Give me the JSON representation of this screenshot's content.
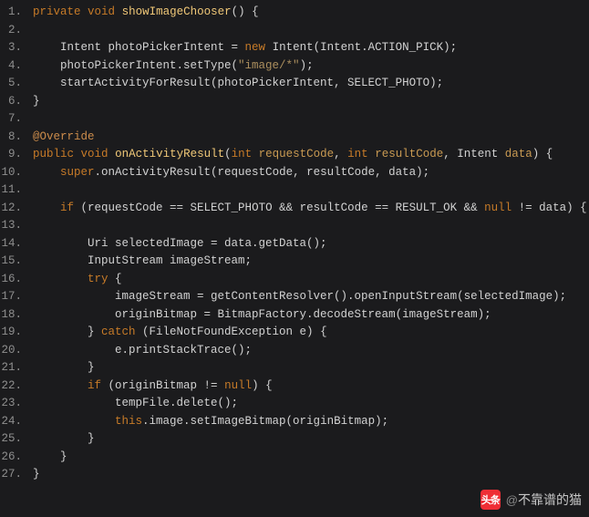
{
  "lines": [
    {
      "n": "1.",
      "segs": [
        {
          "c": "kw",
          "t": "private"
        },
        {
          "t": " "
        },
        {
          "c": "kw",
          "t": "void"
        },
        {
          "t": " "
        },
        {
          "c": "fn",
          "t": "showImageChooser"
        },
        {
          "t": "() {"
        }
      ]
    },
    {
      "n": "2.",
      "segs": []
    },
    {
      "n": "3.",
      "segs": [
        {
          "t": "    Intent photoPickerIntent = "
        },
        {
          "c": "kw",
          "t": "new"
        },
        {
          "t": " Intent(Intent.ACTION_PICK);"
        }
      ]
    },
    {
      "n": "4.",
      "segs": [
        {
          "t": "    photoPickerIntent.setType("
        },
        {
          "c": "str",
          "t": "\"image/*\""
        },
        {
          "t": ");"
        }
      ]
    },
    {
      "n": "5.",
      "segs": [
        {
          "t": "    startActivityForResult(photoPickerIntent, SELECT_PHOTO);"
        }
      ]
    },
    {
      "n": "6.",
      "segs": [
        {
          "t": "}"
        }
      ]
    },
    {
      "n": "7.",
      "segs": []
    },
    {
      "n": "8.",
      "segs": [
        {
          "c": "ann",
          "t": "@Override"
        }
      ]
    },
    {
      "n": "9.",
      "segs": [
        {
          "c": "kw",
          "t": "public"
        },
        {
          "t": " "
        },
        {
          "c": "kw",
          "t": "void"
        },
        {
          "t": " "
        },
        {
          "c": "fn",
          "t": "onActivityResult"
        },
        {
          "t": "("
        },
        {
          "c": "kw",
          "t": "int"
        },
        {
          "t": " "
        },
        {
          "c": "param",
          "t": "requestCode"
        },
        {
          "t": ", "
        },
        {
          "c": "kw",
          "t": "int"
        },
        {
          "t": " "
        },
        {
          "c": "param",
          "t": "resultCode"
        },
        {
          "t": ", Intent "
        },
        {
          "c": "param",
          "t": "data"
        },
        {
          "t": ") {"
        }
      ]
    },
    {
      "n": "10.",
      "segs": [
        {
          "t": "    "
        },
        {
          "c": "kw",
          "t": "super"
        },
        {
          "t": ".onActivityResult(requestCode, resultCode, data);"
        }
      ]
    },
    {
      "n": "11.",
      "segs": []
    },
    {
      "n": "12.",
      "segs": [
        {
          "t": "    "
        },
        {
          "c": "kw",
          "t": "if"
        },
        {
          "t": " (requestCode == SELECT_PHOTO && resultCode == RESULT_OK && "
        },
        {
          "c": "kw",
          "t": "null"
        },
        {
          "t": " != data) {"
        }
      ]
    },
    {
      "n": "13.",
      "segs": []
    },
    {
      "n": "14.",
      "segs": [
        {
          "t": "        Uri selectedImage = data.getData();"
        }
      ]
    },
    {
      "n": "15.",
      "segs": [
        {
          "t": "        InputStream imageStream;"
        }
      ]
    },
    {
      "n": "16.",
      "segs": [
        {
          "t": "        "
        },
        {
          "c": "kw",
          "t": "try"
        },
        {
          "t": " {"
        }
      ]
    },
    {
      "n": "17.",
      "segs": [
        {
          "t": "            imageStream = getContentResolver().openInputStream(selectedImage);"
        }
      ]
    },
    {
      "n": "18.",
      "segs": [
        {
          "t": "            originBitmap = BitmapFactory.decodeStream(imageStream);"
        }
      ]
    },
    {
      "n": "19.",
      "segs": [
        {
          "t": "        } "
        },
        {
          "c": "kw",
          "t": "catch"
        },
        {
          "t": " (FileNotFoundException e) {"
        }
      ]
    },
    {
      "n": "20.",
      "segs": [
        {
          "t": "            e.printStackTrace();"
        }
      ]
    },
    {
      "n": "21.",
      "segs": [
        {
          "t": "        }"
        }
      ]
    },
    {
      "n": "22.",
      "segs": [
        {
          "t": "        "
        },
        {
          "c": "kw",
          "t": "if"
        },
        {
          "t": " (originBitmap != "
        },
        {
          "c": "kw",
          "t": "null"
        },
        {
          "t": ") {"
        }
      ]
    },
    {
      "n": "23.",
      "segs": [
        {
          "t": "            tempFile.delete();"
        }
      ]
    },
    {
      "n": "24.",
      "segs": [
        {
          "t": "            "
        },
        {
          "c": "kw",
          "t": "this"
        },
        {
          "t": ".image.setImageBitmap(originBitmap);"
        }
      ]
    },
    {
      "n": "25.",
      "segs": [
        {
          "t": "        }"
        }
      ]
    },
    {
      "n": "26.",
      "segs": [
        {
          "t": "    }"
        }
      ]
    },
    {
      "n": "27.",
      "segs": [
        {
          "t": "}"
        }
      ]
    }
  ],
  "watermark": {
    "logo_text": "头条",
    "at": "@",
    "name": "不靠谱的猫"
  }
}
